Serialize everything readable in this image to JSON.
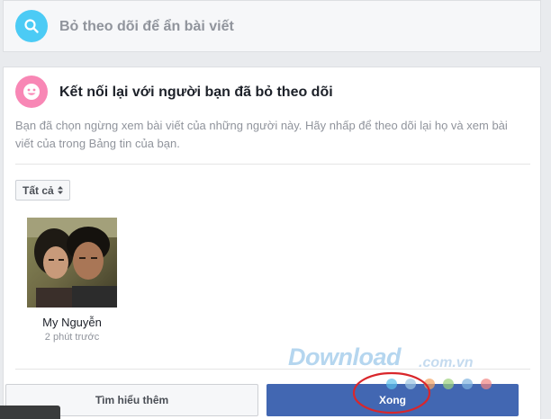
{
  "unfollow_section": {
    "title": "Bỏ theo dõi để ẩn bài viết",
    "icon": "search-icon",
    "icon_color": "#4ccbf5"
  },
  "reconnect_section": {
    "title": "Kết nối lại với người bạn đã bỏ theo dõi",
    "icon": "smile-icon",
    "icon_color": "#f887b5",
    "description": "Bạn đã chọn ngừng xem bài viết của những người này. Hãy nhấp để theo dõi lại họ và xem bài viết của trong Bảng tin của bạn.",
    "filter_label": "Tất cả",
    "people": [
      {
        "name": "My Nguyễn",
        "time": "2 phút trước"
      }
    ]
  },
  "footer": {
    "learn_more_label": "Tìm hiểu thêm",
    "done_label": "Xong",
    "primary_color": "#4267b2"
  },
  "watermark": {
    "brand": "Download",
    "tld": ".com.vn"
  }
}
